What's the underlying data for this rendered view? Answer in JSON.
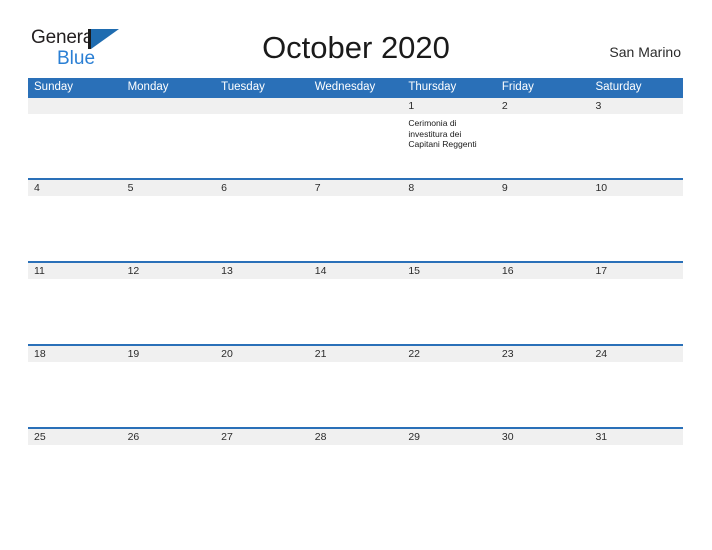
{
  "brand": {
    "line1": "General",
    "line2": "Blue",
    "mark": "flag-triangle-icon",
    "color_dark": "#231f20",
    "color_blue": "#2a7fd4"
  },
  "header": {
    "title": "October 2020",
    "region": "San Marino"
  },
  "theme": {
    "header_blue": "#2a70b8",
    "row_divider_blue": "#2a70b8",
    "number_band_gray": "#f0f0f0",
    "text_dark": "#1a1a1a"
  },
  "calendar": {
    "day_headers": [
      "Sunday",
      "Monday",
      "Tuesday",
      "Wednesday",
      "Thursday",
      "Friday",
      "Saturday"
    ],
    "weeks": [
      {
        "days": [
          {
            "num": "",
            "event": ""
          },
          {
            "num": "",
            "event": ""
          },
          {
            "num": "",
            "event": ""
          },
          {
            "num": "",
            "event": ""
          },
          {
            "num": "1",
            "event": "Cerimonia di investitura dei Capitani Reggenti"
          },
          {
            "num": "2",
            "event": ""
          },
          {
            "num": "3",
            "event": ""
          }
        ]
      },
      {
        "days": [
          {
            "num": "4",
            "event": ""
          },
          {
            "num": "5",
            "event": ""
          },
          {
            "num": "6",
            "event": ""
          },
          {
            "num": "7",
            "event": ""
          },
          {
            "num": "8",
            "event": ""
          },
          {
            "num": "9",
            "event": ""
          },
          {
            "num": "10",
            "event": ""
          }
        ]
      },
      {
        "days": [
          {
            "num": "11",
            "event": ""
          },
          {
            "num": "12",
            "event": ""
          },
          {
            "num": "13",
            "event": ""
          },
          {
            "num": "14",
            "event": ""
          },
          {
            "num": "15",
            "event": ""
          },
          {
            "num": "16",
            "event": ""
          },
          {
            "num": "17",
            "event": ""
          }
        ]
      },
      {
        "days": [
          {
            "num": "18",
            "event": ""
          },
          {
            "num": "19",
            "event": ""
          },
          {
            "num": "20",
            "event": ""
          },
          {
            "num": "21",
            "event": ""
          },
          {
            "num": "22",
            "event": ""
          },
          {
            "num": "23",
            "event": ""
          },
          {
            "num": "24",
            "event": ""
          }
        ]
      },
      {
        "days": [
          {
            "num": "25",
            "event": ""
          },
          {
            "num": "26",
            "event": ""
          },
          {
            "num": "27",
            "event": ""
          },
          {
            "num": "28",
            "event": ""
          },
          {
            "num": "29",
            "event": ""
          },
          {
            "num": "30",
            "event": ""
          },
          {
            "num": "31",
            "event": ""
          }
        ]
      }
    ]
  }
}
